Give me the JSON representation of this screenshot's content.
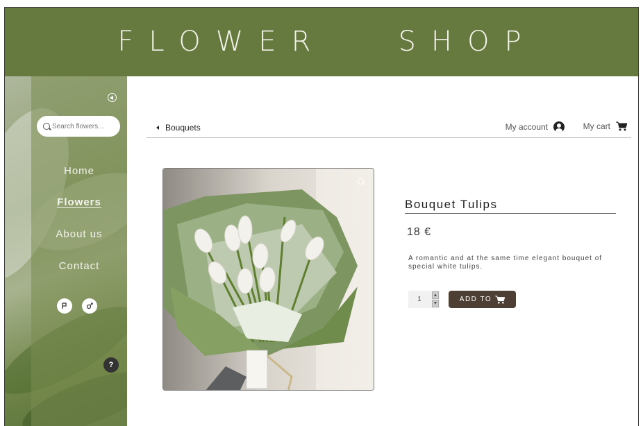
{
  "header": {
    "title": "FLOWER   SHOP"
  },
  "sidebar": {
    "search_placeholder": "Search flowers...",
    "nav": [
      {
        "label": "Home"
      },
      {
        "label": "Flowers",
        "active": true
      },
      {
        "label": "About us"
      },
      {
        "label": "Contact"
      }
    ],
    "language_buttons": [
      "flag-icon",
      "gender-icon"
    ],
    "help_label": "?"
  },
  "topbar": {
    "breadcrumb": "Bouquets",
    "account_label": "My account",
    "cart_label": "My cart"
  },
  "product": {
    "title": "Bouquet Tulips",
    "price": "18 €",
    "description": "A romantic and at the same time elegant bouquet of special white tulips.",
    "quantity": "1",
    "add_button": "ADD TO"
  },
  "colors": {
    "header_bg": "#667a3f",
    "button_bg": "#4e3f35"
  }
}
